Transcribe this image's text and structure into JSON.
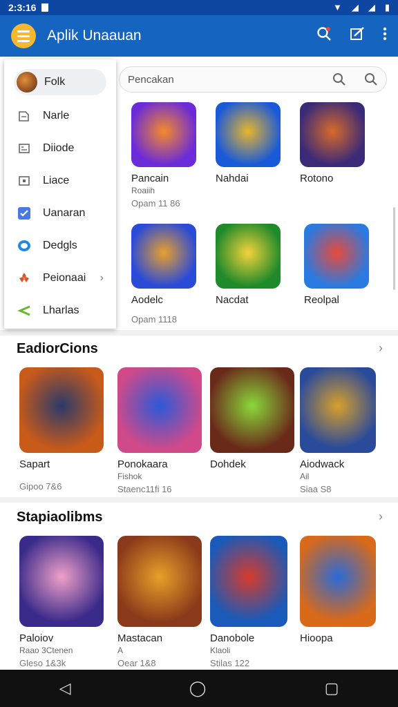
{
  "status_bar": {
    "time": "2:3:16"
  },
  "app_bar": {
    "title": "Aplik Unaauan"
  },
  "search": {
    "placeholder": "Pencakan"
  },
  "drawer": {
    "items": [
      {
        "label": "Folk",
        "icon": "avatar"
      },
      {
        "label": "Narle",
        "icon": "home-icon"
      },
      {
        "label": "Diiode",
        "icon": "grid-icon"
      },
      {
        "label": "Liace",
        "icon": "window-icon"
      },
      {
        "label": "Uanaran",
        "icon": "check-icon"
      },
      {
        "label": "Dedgls",
        "icon": "chat-icon"
      },
      {
        "label": "Peionaai",
        "icon": "puzzle-icon"
      },
      {
        "label": "Lharlas",
        "icon": "share-icon"
      }
    ]
  },
  "featured": [
    {
      "title": "Pancain",
      "sub": "Roaiih",
      "meta": "Opam 11 86",
      "colors": [
        "#6b2bd8",
        "#f58a2a"
      ]
    },
    {
      "title": "Nahdai",
      "sub": "",
      "meta": "",
      "colors": [
        "#1a5ad8",
        "#e8b52c"
      ]
    },
    {
      "title": "Rotono",
      "sub": "",
      "meta": "",
      "colors": [
        "#3a2a78",
        "#d86a2a"
      ]
    },
    {
      "title": "Aodelc",
      "sub": "",
      "meta": "Opam 1118",
      "colors": [
        "#2a4ad8",
        "#e8a02c"
      ]
    },
    {
      "title": "Nacdat",
      "sub": "",
      "meta": "",
      "colors": [
        "#1e8a2a",
        "#f5d23a"
      ]
    },
    {
      "title": "Reolpal",
      "sub": "",
      "meta": "",
      "colors": [
        "#2a7ae0",
        "#e84a3a"
      ]
    }
  ],
  "sections": [
    {
      "title": "EadiorCions",
      "cards": [
        {
          "title": "Sapart",
          "sub": "",
          "meta": "Gipoo 7&6",
          "colors": [
            "#c85a1a",
            "#2a3a6a"
          ]
        },
        {
          "title": "Ponokaara",
          "sub": "Fishok",
          "meta": "Staenc11fi 16",
          "colors": [
            "#d04a8a",
            "#2a5ad8"
          ]
        },
        {
          "title": "Dohdek",
          "sub": "",
          "meta": "",
          "colors": [
            "#6a2a1a",
            "#8ad83a"
          ]
        },
        {
          "title": "Aiodwack",
          "sub": "Ail",
          "meta": "Siaa S8",
          "colors": [
            "#2a4a9a",
            "#d8a02a"
          ]
        }
      ]
    },
    {
      "title": "Stapiaolibms",
      "cards": [
        {
          "title": "Paloiov",
          "sub": "Raao 3Ctenen",
          "meta": "Gleso 1&3k",
          "colors": [
            "#3a2a8a",
            "#f0a0c8"
          ]
        },
        {
          "title": "Mastacan",
          "sub": "A",
          "meta": "Oear 1&8",
          "colors": [
            "#8a3a1a",
            "#e8a02a"
          ]
        },
        {
          "title": "Danobole",
          "sub": "Klaoli",
          "meta": "Stilas 122",
          "colors": [
            "#1a5ab8",
            "#d83a2a"
          ]
        },
        {
          "title": "Hioopa",
          "sub": "",
          "meta": "",
          "colors": [
            "#d86a1a",
            "#2a6ad8"
          ]
        }
      ]
    }
  ],
  "nav": {
    "back": "◁",
    "home": "◯",
    "recents": "▢"
  }
}
